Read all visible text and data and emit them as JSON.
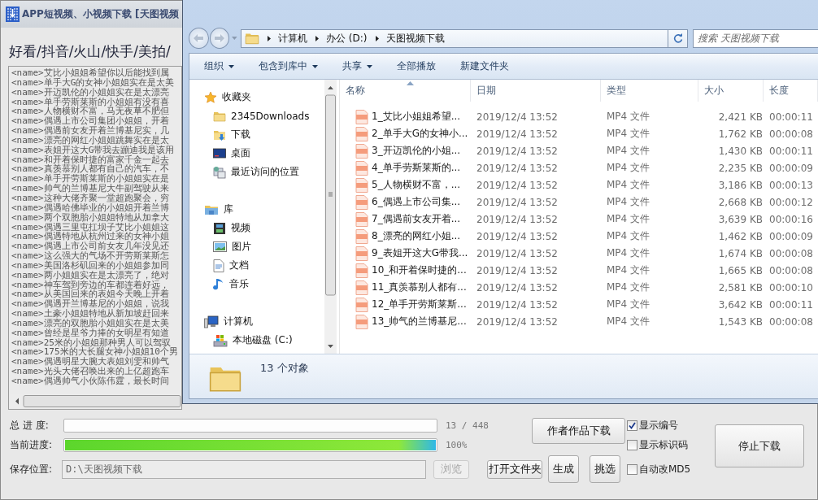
{
  "app_window": {
    "title": "APP短视频、小视频下载 [天图视频",
    "platforms_label": "好看/抖音/火山/快手/美拍/",
    "lines": [
      "<name>艾比小姐姐希望你以后能找到属",
      "<name>单手大G的女神小姐姐实在是太美",
      "<name>开迈凯伦的小姐姐实在是太漂亮",
      "<name>单手劳斯莱斯的小姐姐有没有喜",
      "<name>人物横财不富，马无夜草不肥但",
      "<name>偶遇上市公司集团小姐姐，开着",
      "<name>偶遇前女友开着兰博基尼实，几",
      "<name>漂亮的网红小姐姐跳舞实在是太",
      "<name>表姐开这大G带我去蹦迪我是该用",
      "<name>和开着保时捷的富家千金一起去",
      "<name>真羡慕别人都有自己的汽车，不",
      "<name>单手开劳斯莱斯的小姐姐实在是",
      "<name>帅气的兰博基尼大牛副驾驶从来",
      "<name>这种大佬齐聚一堂超跑聚会，穷",
      "<name>偶遇哈佛毕业的小姐姐开着兰博",
      "<name>两个双胞胎小姐姐特地从加拿大",
      "<name>偶遇三里屯扛坝子艾比小姐姐这",
      "<name>偶遇特地从杭州过来的女神小姐",
      "<name>偶遇上市公司前女友几年没见还",
      "<name>这么强大的气场不开劳斯莱斯怎",
      "<name>美国洛杉矶回来的小姐姐参加同",
      "<name>两小姐姐实在是太漂亮了，绝对",
      "<name>神车驾到旁边的车都连着好远，",
      "<name>从美国回来的表姐今天晚上开着",
      "<name>偶遇开兰博基尼的小姐姐，说我",
      "<name>土豪小姐姐特地从新加坡赶回来",
      "<name>漂亮的双胞胎小姐姐实在是太美",
      "<name>曾经是星爷力捧的女明星有知道",
      "<name>25米的小姐姐那种男人可以驾驭",
      "<name>175米的大长腿女神小姐姐10个男",
      "<name>偶遇明星大腕大表姐刘雯和帅气",
      "<name>光头大佬召唤出来的上亿超跑车",
      "<name>偶遇帅气小伙陈伟霆，最长时间"
    ],
    "total_progress": {
      "label": "总 进 度:",
      "level": 0,
      "reading": "13 / 448"
    },
    "current_progress": {
      "label": "当前进度:",
      "level": 1,
      "reading": "100%"
    },
    "save_location": {
      "label": "保存位置:",
      "value": "D:\\天图视频下载",
      "disabled": true
    },
    "browse_button": {
      "label": "浏览",
      "disabled": true
    },
    "open_folder_button": {
      "label": "打开文件夹",
      "disabled": false
    },
    "author_download_button": {
      "label": "作者作品下载",
      "disabled": false
    },
    "generate_button": {
      "label": "生成",
      "disabled": false
    },
    "pick_button": {
      "label": "挑选",
      "disabled": false
    },
    "checkboxes": [
      {
        "label": "显示编号",
        "checked": true
      },
      {
        "label": "显示标识码",
        "checked": false
      },
      {
        "label": "自动改MD5",
        "checked": false
      }
    ],
    "stop_button": {
      "label": "停止下载",
      "disabled": false
    }
  },
  "explorer": {
    "breadcrumb": [
      "计算机",
      "办公 (D:)",
      "天图视频下载"
    ],
    "search": {
      "placeholder": "搜索 天图视频下载"
    },
    "toolbar": [
      {
        "label": "组织",
        "dropdown": true
      },
      {
        "label": "包含到库中",
        "dropdown": true
      },
      {
        "label": "共享",
        "dropdown": true
      },
      {
        "label": "全部播放",
        "dropdown": false
      },
      {
        "label": "新建文件夹",
        "dropdown": false
      }
    ],
    "nav": [
      {
        "label": "收藏夹",
        "kind": "favorites",
        "children": [
          {
            "label": "2345Downloads",
            "kind": "folder"
          },
          {
            "label": "下载",
            "kind": "downloads"
          },
          {
            "label": "桌面",
            "kind": "desktop"
          },
          {
            "label": "最近访问的位置",
            "kind": "recent"
          }
        ]
      },
      {
        "label": "库",
        "kind": "library",
        "children": [
          {
            "label": "视频",
            "kind": "videos"
          },
          {
            "label": "图片",
            "kind": "pictures"
          },
          {
            "label": "文档",
            "kind": "documents"
          },
          {
            "label": "音乐",
            "kind": "music"
          }
        ]
      },
      {
        "label": "计算机",
        "kind": "computer",
        "children": [
          {
            "label": "本地磁盘 (C:)",
            "kind": "drive"
          }
        ]
      }
    ],
    "columns": [
      {
        "label": "名称",
        "sorted": true
      },
      {
        "label": "日期",
        "sorted": false
      },
      {
        "label": "类型",
        "sorted": false
      },
      {
        "label": "大小",
        "sorted": false
      },
      {
        "label": "长度",
        "sorted": false
      }
    ],
    "rows": [
      {
        "name": "1_艾比小姐姐希望...",
        "date": "2019/12/4 13:52",
        "type": "MP4 文件",
        "size": "2,421 KB",
        "length": "00:00:11"
      },
      {
        "name": "2_单手大G的女神小...",
        "date": "2019/12/4 13:52",
        "type": "MP4 文件",
        "size": "1,762 KB",
        "length": "00:00:08"
      },
      {
        "name": "3_开迈凯伦的小姐...",
        "date": "2019/12/4 13:52",
        "type": "MP4 文件",
        "size": "1,430 KB",
        "length": "00:00:11"
      },
      {
        "name": "4_单手劳斯莱斯的...",
        "date": "2019/12/4 13:52",
        "type": "MP4 文件",
        "size": "2,235 KB",
        "length": "00:00:09"
      },
      {
        "name": "5_人物横财不富，...",
        "date": "2019/12/4 13:52",
        "type": "MP4 文件",
        "size": "3,186 KB",
        "length": "00:00:13"
      },
      {
        "name": "6_偶遇上市公司集...",
        "date": "2019/12/4 13:52",
        "type": "MP4 文件",
        "size": "2,668 KB",
        "length": "00:00:12"
      },
      {
        "name": "7_偶遇前女友开着...",
        "date": "2019/12/4 13:52",
        "type": "MP4 文件",
        "size": "3,639 KB",
        "length": "00:00:16"
      },
      {
        "name": "8_漂亮的网红小姐...",
        "date": "2019/12/4 13:52",
        "type": "MP4 文件",
        "size": "1,462 KB",
        "length": "00:00:09"
      },
      {
        "name": "9_表姐开这大G带我...",
        "date": "2019/12/4 13:52",
        "type": "MP4 文件",
        "size": "1,674 KB",
        "length": "00:00:08"
      },
      {
        "name": "10_和开着保时捷的...",
        "date": "2019/12/4 13:52",
        "type": "MP4 文件",
        "size": "1,665 KB",
        "length": "00:00:08"
      },
      {
        "name": "11_真羡慕别人都有...",
        "date": "2019/12/4 13:52",
        "type": "MP4 文件",
        "size": "2,581 KB",
        "length": "00:00:10"
      },
      {
        "name": "12_单手开劳斯莱斯...",
        "date": "2019/12/4 13:52",
        "type": "MP4 文件",
        "size": "3,642 KB",
        "length": "00:00:11"
      },
      {
        "name": "13_帅气的兰博基尼...",
        "date": "2019/12/4 13:52",
        "type": "MP4 文件",
        "size": "1,543 KB",
        "length": "00:00:08"
      }
    ],
    "status": "13 个对象"
  }
}
